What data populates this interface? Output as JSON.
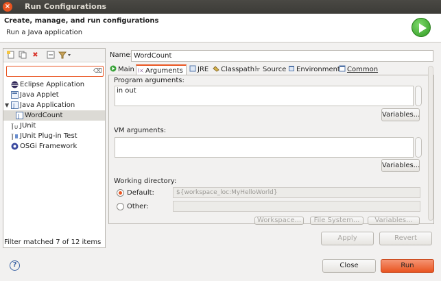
{
  "window": {
    "title": "Run Configurations"
  },
  "header": {
    "title": "Create, manage, and run configurations",
    "subtitle": "Run a Java application"
  },
  "left": {
    "toolbar_icons": [
      "new-config-icon",
      "duplicate-icon",
      "delete-icon",
      "collapse-all-icon",
      "filter-icon"
    ],
    "filter": {
      "value": "",
      "placeholder": ""
    },
    "tree": [
      {
        "label": "Eclipse Application",
        "icon": "eclipse-icon"
      },
      {
        "label": "Java Applet",
        "icon": "applet-icon"
      },
      {
        "label": "Java Application",
        "icon": "java-app-icon",
        "expanded": true
      },
      {
        "label": "WordCount",
        "icon": "java-config-icon",
        "selected": true
      },
      {
        "label": "JUnit",
        "icon": "junit-icon"
      },
      {
        "label": "JUnit Plug-in Test",
        "icon": "junit-plugin-icon"
      },
      {
        "label": "OSGi Framework",
        "icon": "osgi-icon"
      }
    ],
    "status": "Filter matched 7 of 12 items"
  },
  "right": {
    "name_label": "Name:",
    "name_value": "WordCount",
    "tabs": [
      {
        "label": "Main",
        "icon": "main-tab-icon"
      },
      {
        "label": "Arguments",
        "icon": "arguments-tab-icon",
        "active": true
      },
      {
        "label": "JRE",
        "icon": "jre-tab-icon"
      },
      {
        "label": "Classpath",
        "icon": "classpath-tab-icon"
      },
      {
        "label": "Source",
        "icon": "source-tab-icon"
      },
      {
        "label": "Environment",
        "icon": "environment-tab-icon"
      },
      {
        "label": "Common",
        "icon": "common-tab-icon"
      }
    ],
    "program_args_label": "Program arguments:",
    "program_args_value": "in out",
    "vm_args_label": "VM arguments:",
    "vm_args_value": "",
    "variables_label": "Variables...",
    "working_dir_label": "Working directory:",
    "default_label": "Default:",
    "default_value": "${workspace_loc:MyHelloWorld}",
    "other_label": "Other:",
    "other_value": "",
    "workspace_label": "Workspace...",
    "filesystem_label": "File System...",
    "variables2_label": "Variables...",
    "apply_label": "Apply",
    "revert_label": "Revert"
  },
  "footer": {
    "close_label": "Close",
    "run_label": "Run"
  },
  "colors": {
    "accent": "#e95420",
    "titlebar": "#3c3b37"
  }
}
